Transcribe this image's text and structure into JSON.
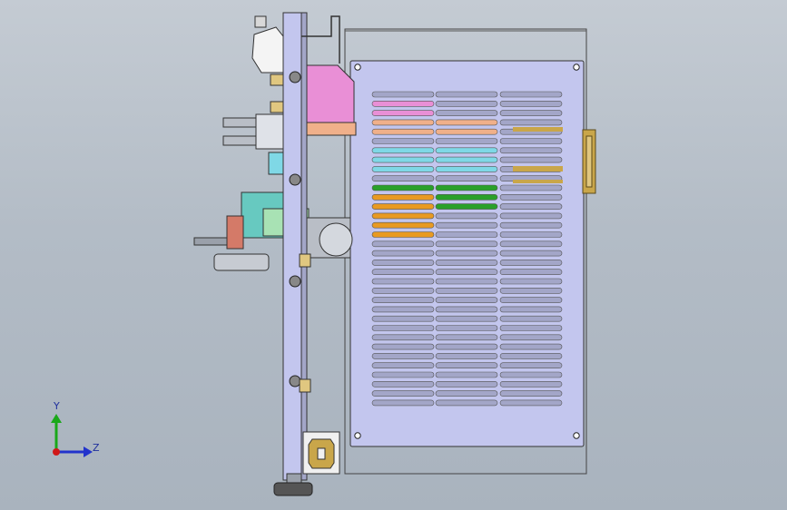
{
  "viewport": {
    "background_top": "#c4cbd3",
    "background_bottom": "#a9b3be"
  },
  "triad": {
    "y_label": "Y",
    "z_label": "Z",
    "y_color": "#1aa81a",
    "z_color": "#2233cc",
    "x_color": "#d01818"
  },
  "colors": {
    "housing_fill": "#bfc3f0",
    "housing_stroke": "#3a3a5a",
    "plate_fill": "#c3c6ee",
    "slot_fill": "#a3a6c8",
    "pink": "#e98fd6",
    "salmon": "#f0b08a",
    "cyan": "#7fd8e6",
    "teal": "#67c9c0",
    "green": "#2aa02a",
    "orange": "#e89a22",
    "gold": "#c9a64a",
    "salmon_red": "#d47a68",
    "grey_metal": "#b9bec6"
  },
  "assembly": {
    "slot_rows": 34
  }
}
